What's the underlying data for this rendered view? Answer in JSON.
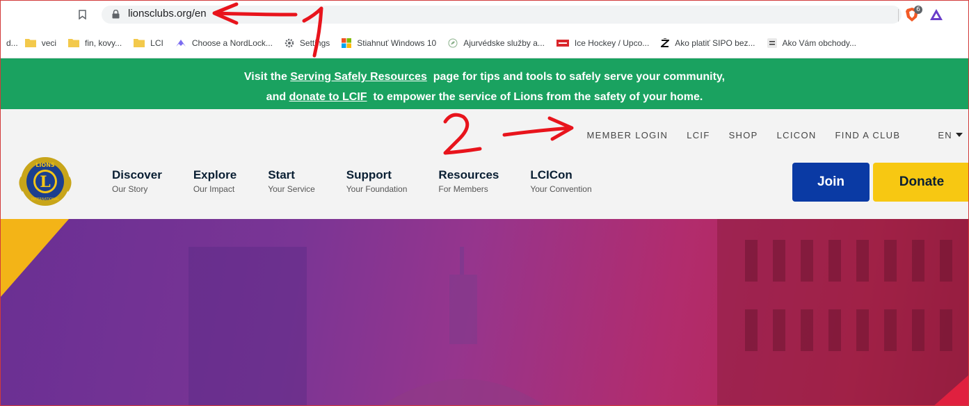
{
  "browser": {
    "url": "lionsclubs.org/en",
    "extension_badge": "6",
    "bookmarks": [
      {
        "label": "d...",
        "icon": "none"
      },
      {
        "label": "veci",
        "icon": "folder-icon"
      },
      {
        "label": "fin, kovy...",
        "icon": "folder-icon"
      },
      {
        "label": "LCI",
        "icon": "folder-icon"
      },
      {
        "label": "Choose a NordLock...",
        "icon": "nordlocker-icon"
      },
      {
        "label": "Settings",
        "icon": "gear-icon"
      },
      {
        "label": "Stiahnuť Windows 10",
        "icon": "windows-icon"
      },
      {
        "label": "Ajurvédske služby a...",
        "icon": "leaf-icon"
      },
      {
        "label": "Ice Hockey / Upco...",
        "icon": "live-icon"
      },
      {
        "label": "Ako platiť SIPO bez...",
        "icon": "z-icon"
      },
      {
        "label": "Ako Vám obchody...",
        "icon": "news-icon"
      }
    ]
  },
  "banner": {
    "line1_pre": "Visit the",
    "line1_link": "Serving Safely Resources",
    "line1_post": "page for tips and tools to safely serve your community,",
    "line2_pre": "and",
    "line2_link": "donate to LCIF",
    "line2_post": "to empower the service of Lions from the safety of your home."
  },
  "topnav": [
    "MEMBER LOGIN",
    "LCIF",
    "SHOP",
    "LCICON",
    "FIND A CLUB",
    "EN"
  ],
  "logo": {
    "letter": "L",
    "top_text": "LIONS",
    "bottom_text": "INTERNATIONAL"
  },
  "mainnav": [
    {
      "title": "Discover",
      "sub": "Our Story"
    },
    {
      "title": "Explore",
      "sub": "Our Impact"
    },
    {
      "title": "Start",
      "sub": "Your Service"
    },
    {
      "title": "Support",
      "sub": "Your Foundation"
    },
    {
      "title": "Resources",
      "sub": "For Members"
    },
    {
      "title": "LCICon",
      "sub": "Your Convention"
    }
  ],
  "buttons": {
    "join": "Join",
    "donate": "Donate"
  },
  "annotations": [
    "1",
    "2"
  ],
  "colors": {
    "banner": "#1aa260",
    "join": "#0a3aa4",
    "donate": "#f7c812",
    "annotation": "#e8141c"
  }
}
